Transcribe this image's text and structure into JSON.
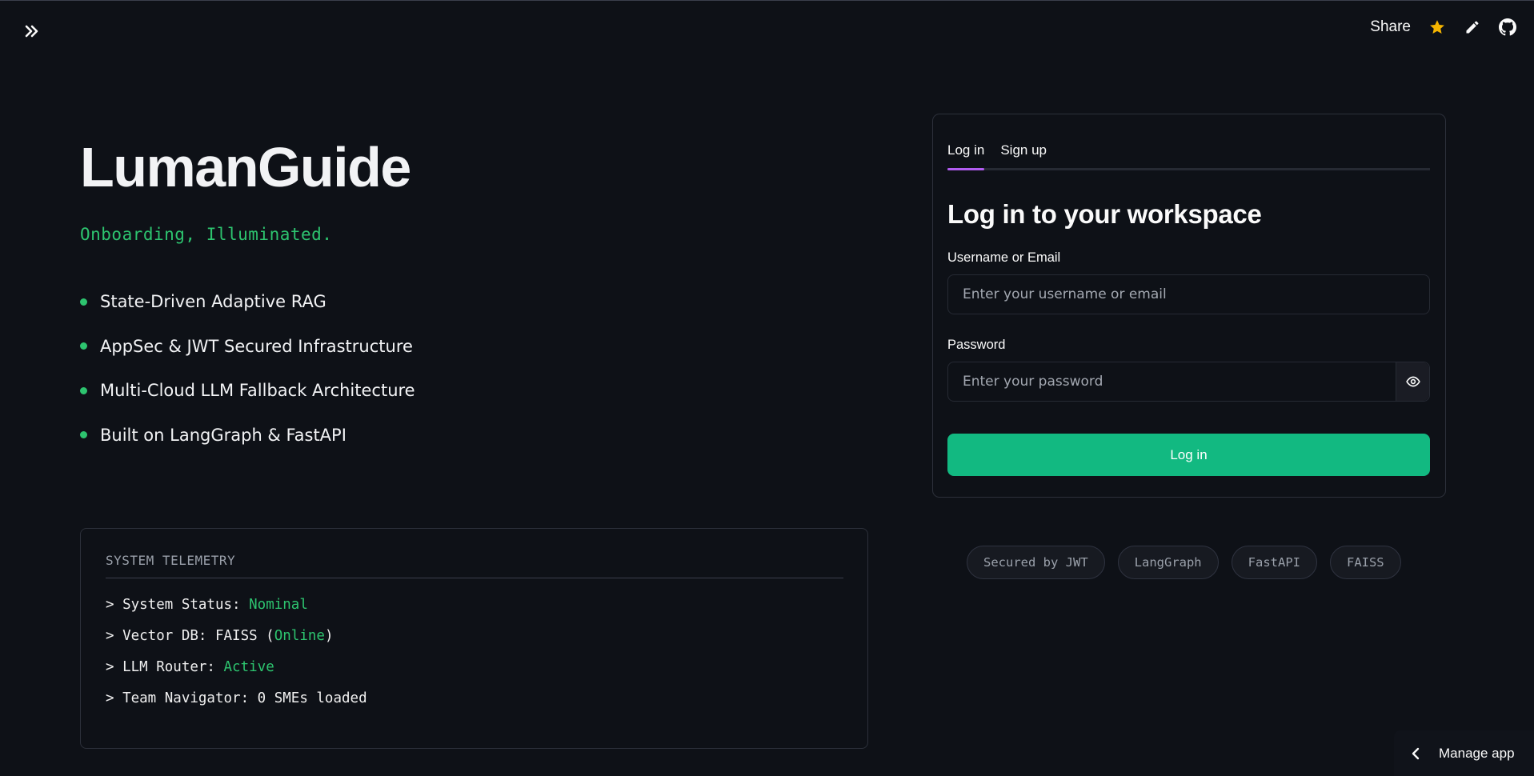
{
  "topbar": {
    "expand_icon": "double-chevron-right-icon",
    "share_label": "Share",
    "star_icon": "star-icon",
    "edit_icon": "pencil-icon",
    "github_icon": "github-icon",
    "star_color": "#f4b400"
  },
  "hero": {
    "title": "LumanGuide",
    "tagline": "Onboarding, Illuminated.",
    "features": [
      "State-Driven Adaptive RAG",
      "AppSec & JWT Secured Infrastructure",
      "Multi-Cloud LLM Fallback Architecture",
      "Built on LangGraph & FastAPI"
    ]
  },
  "telemetry": {
    "heading": "SYSTEM TELEMETRY",
    "lines": [
      {
        "prefix": "> System Status: ",
        "value": "Nominal",
        "suffix": ""
      },
      {
        "prefix": "> Vector DB: FAISS (",
        "value": "Online",
        "suffix": ")"
      },
      {
        "prefix": "> LLM Router: ",
        "value": "Active",
        "suffix": ""
      },
      {
        "prefix": "> Team Navigator: 0 SMEs loaded",
        "value": "",
        "suffix": ""
      }
    ]
  },
  "auth": {
    "tabs": [
      {
        "label": "Log in",
        "active": true
      },
      {
        "label": "Sign up",
        "active": false
      }
    ],
    "title": "Log in to your workspace",
    "username_label": "Username or Email",
    "username_placeholder": "Enter your username or email",
    "password_label": "Password",
    "password_placeholder": "Enter your password",
    "eye_icon": "eye-icon",
    "submit_label": "Log in",
    "accent_color": "#12b981",
    "tab_indicator_color": "#b15cf0"
  },
  "badges": [
    "Secured by JWT",
    "LangGraph",
    "FastAPI",
    "FAISS"
  ],
  "manage_app": {
    "label": "Manage app",
    "icon": "chevron-left-icon"
  }
}
